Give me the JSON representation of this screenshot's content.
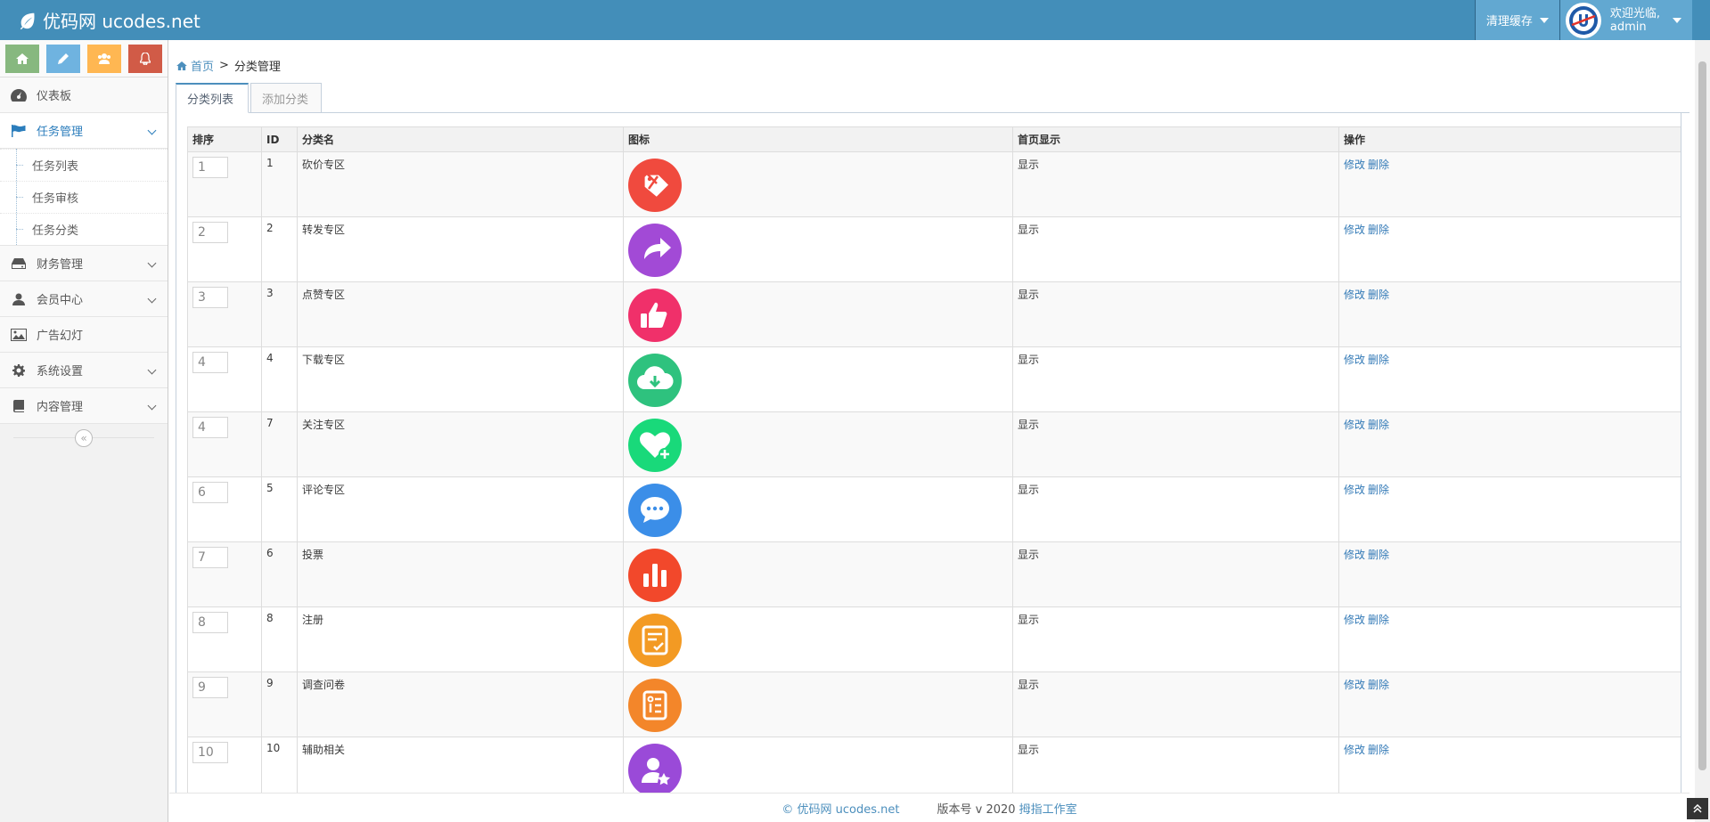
{
  "navbar": {
    "brand": "优码网 ucodes.net",
    "clear_cache": "清理缓存",
    "welcome": "欢迎光临,",
    "username": "admin"
  },
  "sidebar": {
    "shortcuts": [
      {
        "icon": "home-icon",
        "color": "#87b87f"
      },
      {
        "icon": "pencil-icon",
        "color": "#6fb3e0"
      },
      {
        "icon": "users-icon",
        "color": "#ffb752"
      },
      {
        "icon": "bell-icon",
        "color": "#d15b47"
      }
    ],
    "items": [
      {
        "label": "仪表板",
        "icon": "dashboard-icon"
      },
      {
        "label": "任务管理",
        "icon": "flag-icon",
        "expanded": true,
        "children": [
          {
            "label": "任务列表"
          },
          {
            "label": "任务审核"
          },
          {
            "label": "任务分类"
          }
        ]
      },
      {
        "label": "财务管理",
        "icon": "hdd-icon"
      },
      {
        "label": "会员中心",
        "icon": "user-icon"
      },
      {
        "label": "广告幻灯",
        "icon": "picture-icon"
      },
      {
        "label": "系统设置",
        "icon": "cog-icon"
      },
      {
        "label": "内容管理",
        "icon": "book-icon"
      }
    ],
    "collapse_icon": "«"
  },
  "breadcrumb": {
    "home": "首页",
    "separator": ">",
    "current": "分类管理"
  },
  "tabs": [
    {
      "label": "分类列表",
      "active": true
    },
    {
      "label": "添加分类",
      "active": false
    }
  ],
  "table": {
    "headers": [
      "排序",
      "ID",
      "分类名",
      "图标",
      "首页显示",
      "操作"
    ],
    "rows": [
      {
        "sort": "1",
        "id": "1",
        "name": "砍价专区",
        "icon": "price-tag-icon",
        "color": "#f04a3e",
        "show": "显示",
        "edit": "修改",
        "del": "删除"
      },
      {
        "sort": "2",
        "id": "2",
        "name": "转发专区",
        "icon": "share-arrow-icon",
        "color": "#a24ad6",
        "show": "显示",
        "edit": "修改",
        "del": "删除"
      },
      {
        "sort": "3",
        "id": "3",
        "name": "点赞专区",
        "icon": "thumbs-up-icon",
        "color": "#f0306a",
        "show": "显示",
        "edit": "修改",
        "del": "删除"
      },
      {
        "sort": "4",
        "id": "4",
        "name": "下载专区",
        "icon": "cloud-download-icon",
        "color": "#2ec27e",
        "show": "显示",
        "edit": "修改",
        "del": "删除"
      },
      {
        "sort": "4",
        "id": "7",
        "name": "关注专区",
        "icon": "heart-plus-icon",
        "color": "#19d97a",
        "show": "显示",
        "edit": "修改",
        "del": "删除"
      },
      {
        "sort": "6",
        "id": "5",
        "name": "评论专区",
        "icon": "chat-bubble-icon",
        "color": "#3b8ee8",
        "show": "显示",
        "edit": "修改",
        "del": "删除"
      },
      {
        "sort": "7",
        "id": "6",
        "name": "投票",
        "icon": "bar-chart-icon",
        "color": "#f2482b",
        "show": "显示",
        "edit": "修改",
        "del": "删除"
      },
      {
        "sort": "8",
        "id": "8",
        "name": "注册",
        "icon": "checklist-icon",
        "color": "#f39a23",
        "show": "显示",
        "edit": "修改",
        "del": "删除"
      },
      {
        "sort": "9",
        "id": "9",
        "name": "调查问卷",
        "icon": "survey-icon",
        "color": "#f3862a",
        "show": "显示",
        "edit": "修改",
        "del": "删除"
      },
      {
        "sort": "10",
        "id": "10",
        "name": "辅助相关",
        "icon": "user-star-icon",
        "color": "#9a4ad8",
        "show": "显示",
        "edit": "修改",
        "del": "删除"
      }
    ]
  },
  "footer": {
    "copyright": "© 优码网 ucodes.net",
    "version_label": "版本号 v 2020",
    "studio": "拇指工作室"
  }
}
